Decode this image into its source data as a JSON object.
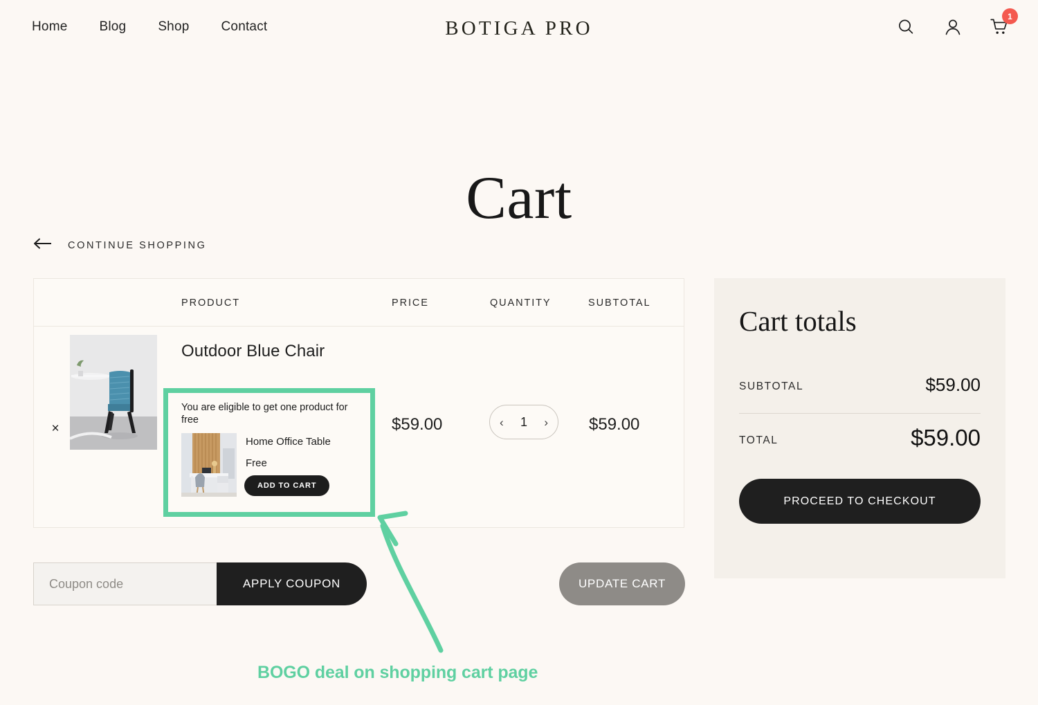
{
  "header": {
    "nav": [
      {
        "label": "Home"
      },
      {
        "label": "Blog"
      },
      {
        "label": "Shop"
      },
      {
        "label": "Contact"
      }
    ],
    "logo": "BOTIGA PRO",
    "icons": {
      "search": "search-icon",
      "account": "account-icon",
      "cart": "cart-icon"
    },
    "cart_badge": "1"
  },
  "page": {
    "title": "Cart",
    "continue_shopping": "CONTINUE SHOPPING"
  },
  "cart_table": {
    "columns": {
      "product": "PRODUCT",
      "price": "PRICE",
      "quantity": "QUANTITY",
      "subtotal": "SUBTOTAL"
    },
    "rows": [
      {
        "remove": "×",
        "name": "Outdoor Blue Chair",
        "price": "$59.00",
        "quantity": "1",
        "qty_decrease": "‹",
        "qty_increase": "›",
        "subtotal": "$59.00"
      }
    ]
  },
  "bogo": {
    "message": "You are eligible to get one product for free",
    "product_name": "Home Office Table",
    "product_price": "Free",
    "add_to_cart": "ADD TO CART",
    "highlight_color": "#5fd0a1"
  },
  "coupon": {
    "placeholder": "Coupon code",
    "value": "",
    "apply_label": "APPLY COUPON"
  },
  "update_cart": {
    "label": "UPDATE CART"
  },
  "totals": {
    "title": "Cart totals",
    "subtotal_label": "SUBTOTAL",
    "subtotal_value": "$59.00",
    "total_label": "TOTAL",
    "total_value": "$59.00",
    "checkout_label": "PROCEED TO CHECKOUT"
  },
  "annotation": {
    "caption": "BOGO deal on shopping cart page",
    "color": "#5fd0a1"
  }
}
